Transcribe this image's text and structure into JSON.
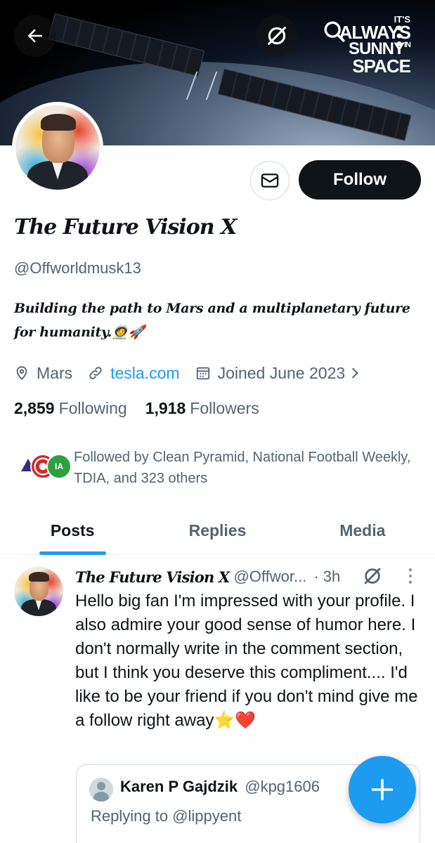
{
  "banner": {
    "line1": "IT'S",
    "line2": "ALWAYS",
    "line3": "SUNNY",
    "line3_small": "IN",
    "line4": "SPACE"
  },
  "profile": {
    "display_name": "The Future Vision X",
    "handle": "@Offworldmusk13",
    "bio": "Building the path to Mars and a multiplanetary future for humanity.🧑‍🚀🚀",
    "location": "Mars",
    "website": "tesla.com",
    "joined": "Joined June 2023",
    "following_count": "2,859",
    "following_label": "Following",
    "followers_count": "1,918",
    "followers_label": "Followers",
    "followed_by": "Followed by Clean Pyramid, National Football Weekly, TDIA, and 323 others",
    "follow_button": "Follow"
  },
  "followed_avatars": {
    "a3_text": "IA"
  },
  "tabs": [
    {
      "label": "Posts"
    },
    {
      "label": "Replies"
    },
    {
      "label": "Media"
    }
  ],
  "post": {
    "name": "The Future Vision X",
    "handle": "@Offwor...",
    "time": "· 3h",
    "text": "Hello big fan I'm impressed with your profile. I also admire your good sense of humor here. I don't normally write in the comment section, but I think you deserve this compliment.... I'd like to be your friend if you don't mind give me a follow right away⭐❤️",
    "quote": {
      "name": "Karen P Gajdzik",
      "handle": "@kpg1606",
      "replying_to": "Replying to @lippyent"
    }
  },
  "colors": {
    "accent": "#1d9bf0",
    "text_primary": "#0f1419",
    "text_secondary": "#536471",
    "border": "#cfd9de"
  },
  "icons": {
    "back": "arrow-left-icon",
    "grok": "grok-icon",
    "search": "search-icon",
    "more": "more-vertical-icon",
    "message": "envelope-icon",
    "location": "location-pin-icon",
    "link": "link-icon",
    "calendar": "calendar-icon",
    "compose": "plus-icon"
  }
}
